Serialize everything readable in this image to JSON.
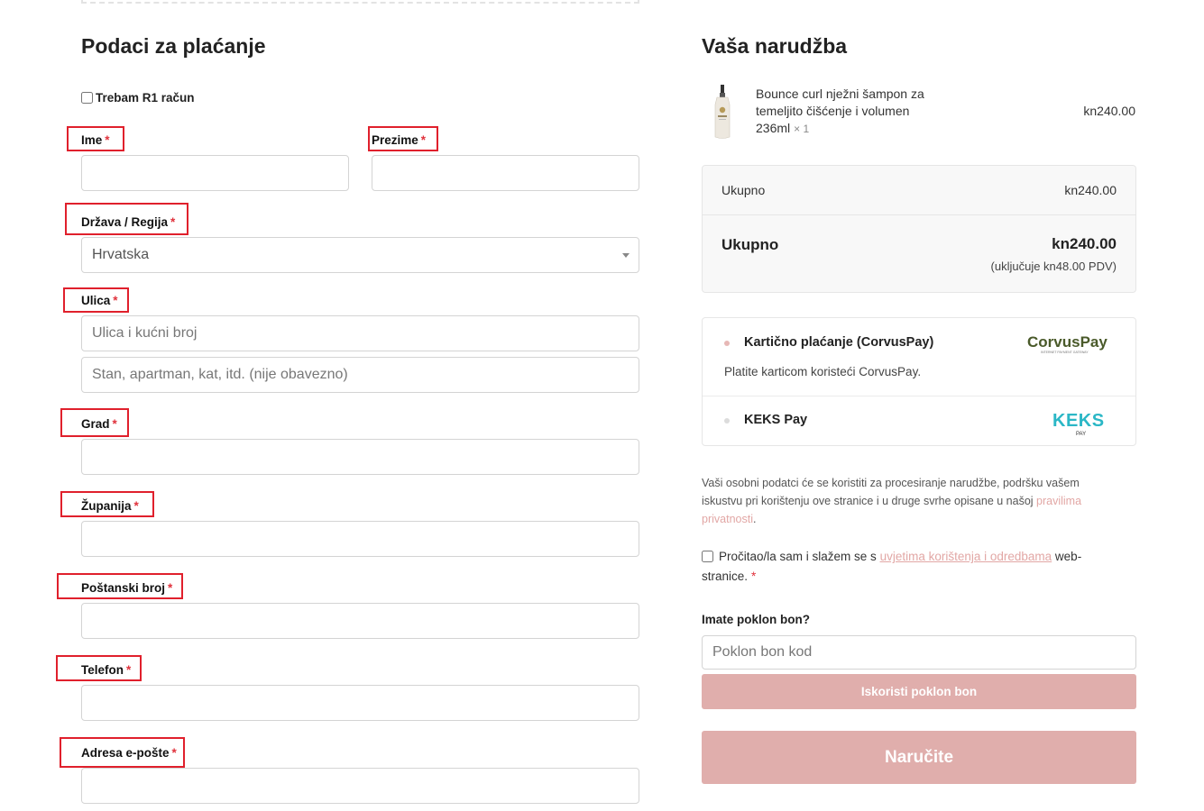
{
  "billing": {
    "title": "Podaci za plaćanje",
    "r1_label": "Trebam R1 račun",
    "fields": {
      "first_name": {
        "label": "Ime",
        "value": ""
      },
      "last_name": {
        "label": "Prezime",
        "value": ""
      },
      "country": {
        "label": "Država / Regija",
        "value": "Hrvatska"
      },
      "street": {
        "label": "Ulica",
        "placeholder": "Ulica i kućni broj",
        "placeholder2": "Stan, apartman, kat, itd. (nije obavezno)"
      },
      "city": {
        "label": "Grad",
        "value": ""
      },
      "county": {
        "label": "Županija",
        "value": ""
      },
      "postcode": {
        "label": "Poštanski broj",
        "value": ""
      },
      "phone": {
        "label": "Telefon",
        "value": ""
      },
      "email": {
        "label": "Adresa e-pošte",
        "value": ""
      }
    },
    "required_mark": "*"
  },
  "order": {
    "title": "Vaša narudžba",
    "product": {
      "name": "Bounce curl nježni šampon za temeljito čišćenje i volumen 236ml",
      "qty": "× 1",
      "price": "kn240.00"
    },
    "subtotal_label": "Ukupno",
    "subtotal_value": "kn240.00",
    "total_label": "Ukupno",
    "total_value": "kn240.00",
    "vat_note": "(uključuje kn48.00 PDV)"
  },
  "payment": {
    "methods": [
      {
        "label": "Kartično plaćanje (CorvusPay)",
        "description": "Platite karticom koristeći CorvusPay.",
        "logo_text": "CorvusPay",
        "logo_sub": "INTERNET PAYMENT GATEWAY",
        "selected": true
      },
      {
        "label": "KEKS Pay",
        "logo_text": "KEKS",
        "logo_sub": "PAY",
        "selected": false
      }
    ]
  },
  "privacy": {
    "text": "Vaši osobni podatci će se koristiti za procesiranje narudžbe, podršku vašem iskustvu pri korištenju ove stranice i u druge svrhe opisane u našoj ",
    "link": "pravilima privatnosti",
    "end": "."
  },
  "terms": {
    "text_before": "Pročitao/la sam i slažem se s ",
    "link": "uvjetima korištenja i odredbama",
    "text_after": " web-stranice.",
    "required_mark": "*"
  },
  "gift": {
    "label": "Imate poklon bon?",
    "placeholder": "Poklon bon kod",
    "button": "Iskoristi poklon bon"
  },
  "order_button": "Naručite",
  "colors": {
    "accent": "#e0aeac",
    "required": "#e0323c",
    "highlight": "#e0202c",
    "link": "#e2a7a5"
  }
}
